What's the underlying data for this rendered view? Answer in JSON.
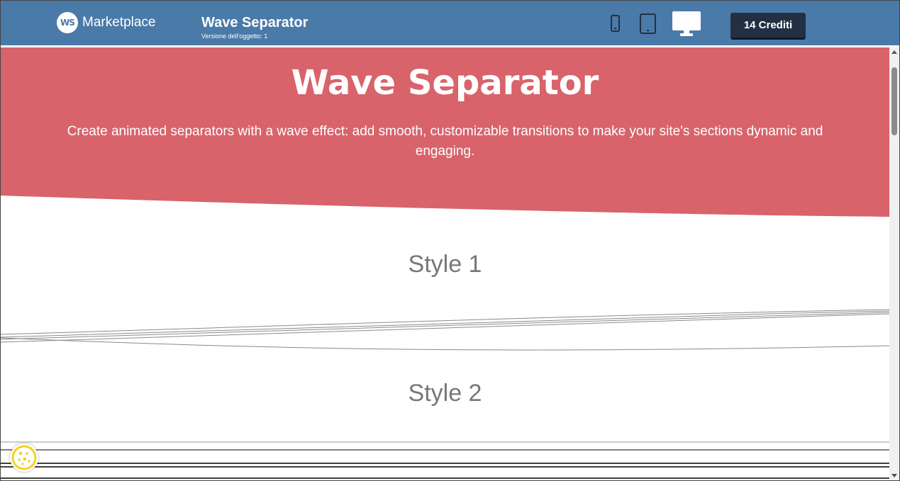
{
  "header": {
    "brand_logo_text": "WS",
    "brand_name": "Marketplace",
    "object_title": "Wave Separator",
    "object_version": "Versione dell'oggetto: 1",
    "devices": [
      "phone-icon",
      "tablet-icon",
      "desktop-icon"
    ],
    "active_device": "desktop",
    "credits_label": "14 Crediti",
    "bar_color": "#4a7aa8",
    "credits_color": "#233044"
  },
  "hero": {
    "title": "Wave Separator",
    "subtitle": "Create animated separators with a wave effect: add smooth, customizable transitions to make your site's sections dynamic and engaging.",
    "background_color": "#d8636b"
  },
  "sections": [
    {
      "heading": "Style 1"
    },
    {
      "heading": "Style 2"
    }
  ],
  "cookie_button": {
    "icon": "cookie-icon",
    "color": "#f2d320"
  }
}
